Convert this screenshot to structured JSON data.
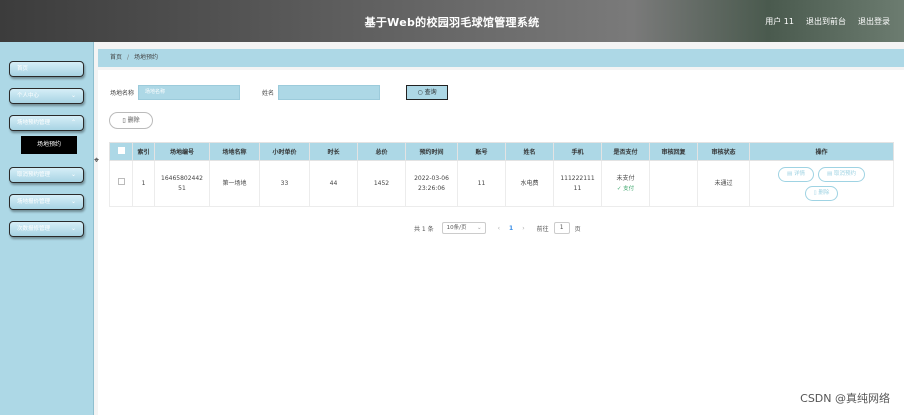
{
  "header": {
    "title": "基于Web的校园羽毛球馆管理系统",
    "user": "用户 11",
    "back_label": "退出到前台",
    "logout_label": "退出登录"
  },
  "sidebar": {
    "items": [
      {
        "label": "首页",
        "chevron": false
      },
      {
        "label": "个人中心",
        "chevron": true
      },
      {
        "label": "场地预约管理",
        "chevron": true
      },
      {
        "label": "取消预约管理",
        "chevron": true
      },
      {
        "label": "场地报价管理",
        "chevron": true
      },
      {
        "label": "次数报修管理",
        "chevron": true
      }
    ],
    "sub_item": "场地预约"
  },
  "breadcrumb": {
    "home": "首页",
    "current": "场地预约"
  },
  "search": {
    "field1_label": "场地名称",
    "field1_placeholder": "场地名称",
    "field2_label": "姓名",
    "field2_placeholder": "",
    "button": "查询"
  },
  "delete_button": "删除",
  "table": {
    "headers": [
      "",
      "索引",
      "场地编号",
      "场地名称",
      "小时单价",
      "时长",
      "总价",
      "预约时间",
      "账号",
      "姓名",
      "手机",
      "是否支付",
      "审核回复",
      "审核状态",
      "操作"
    ],
    "rows": [
      {
        "index": "1",
        "code": "1646580244251",
        "name": "第一场地",
        "price": "33",
        "hours": "44",
        "total": "1452",
        "time": "2022-03-06 23:26:06",
        "account": "11",
        "username": "水电费",
        "phone": "11122211111",
        "paid": "未支付",
        "pay_link": "支付",
        "reply": "",
        "status": "未通过",
        "actions": [
          "详情",
          "取消预约",
          "删除"
        ]
      }
    ]
  },
  "pager": {
    "total": "共 1 条",
    "per_page": "10条/页",
    "prev": "‹",
    "page": "1",
    "next": "›",
    "goto": "前往",
    "goto_value": "1",
    "page_suffix": "页"
  },
  "watermark": "CSDN @真纯网络"
}
